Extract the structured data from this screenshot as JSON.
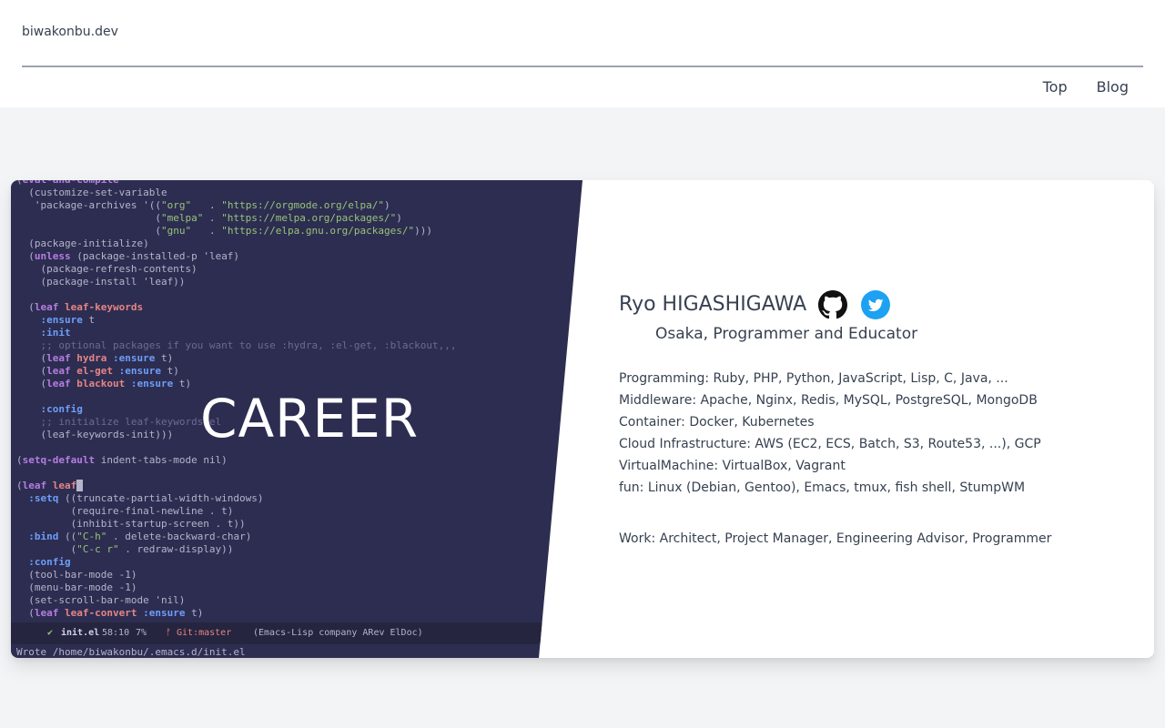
{
  "header": {
    "site_title": "biwakonbu.dev",
    "nav": [
      {
        "label": "Top"
      },
      {
        "label": "Blog"
      }
    ]
  },
  "hero": {
    "title": "CAREER"
  },
  "editor": {
    "modeline": {
      "check": "✔",
      "file": "init.el",
      "position": "58:10",
      "percent": "7%",
      "git": "ᚠ Git:master",
      "modes": "(Emacs-Lisp company ARev ElDoc)"
    },
    "minibuffer": "Wrote /home/biwakonbu/.emacs.d/init.el"
  },
  "profile": {
    "name": "Ryo HIGASHIGAWA",
    "role": "Osaka, Programmer and Educator",
    "skills": [
      "Programming: Ruby, PHP, Python, JavaScript, Lisp, C, Java, ...",
      "Middleware: Apache, Nginx, Redis, MySQL, PostgreSQL, MongoDB",
      "Container: Docker, Kubernetes",
      "Cloud Infrastructure: AWS (EC2, ECS, Batch, S3, Route53, ...), GCP",
      "VirtualMachine: VirtualBox, Vagrant",
      "fun: Linux (Debian, Gentoo), Emacs, tmux, fish shell, StumpWM"
    ],
    "work": "Work: Architect, Project Manager, Engineering Advisor, Programmer"
  },
  "icons": {
    "github": "github-icon",
    "twitter": "twitter-icon"
  },
  "colors": {
    "editor_bg": "#2d2d51",
    "page_bg": "#f3f4f6",
    "twitter_blue": "#1da1f2"
  }
}
